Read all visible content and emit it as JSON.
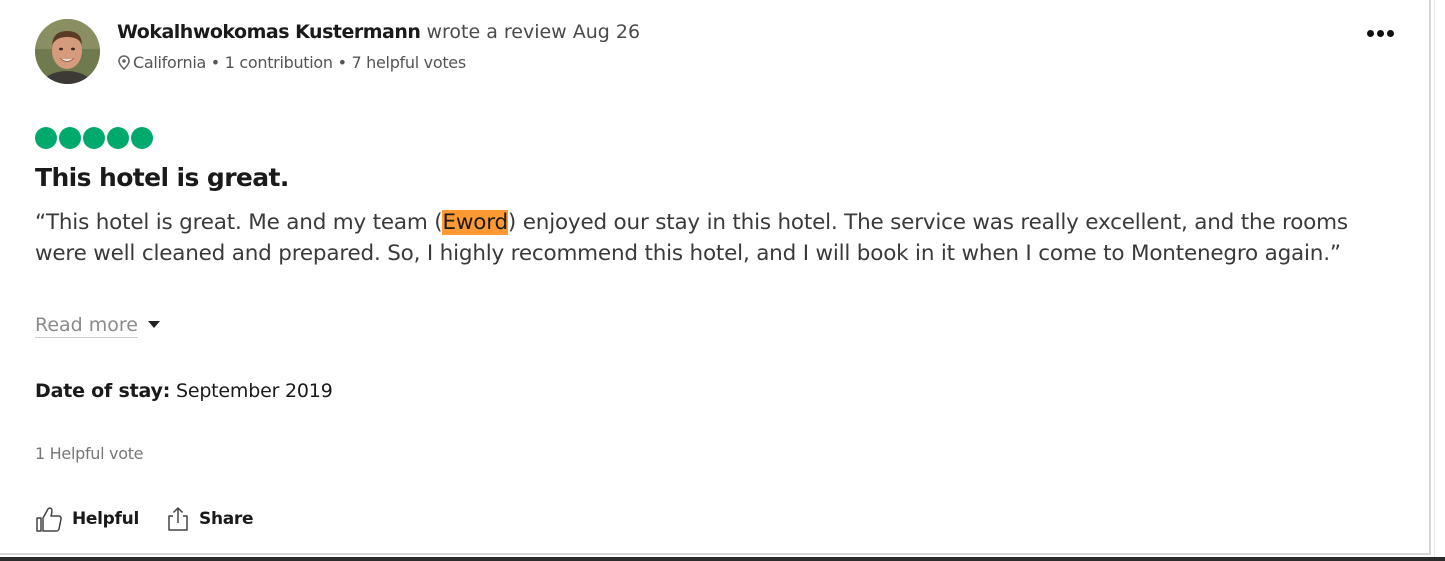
{
  "reviewer": {
    "name": "Wokalhwokomas Kustermann",
    "action": "wrote a review Aug 26",
    "location": "California",
    "contributions": "1 contribution",
    "helpful_votes": "7 helpful votes",
    "separator": "•"
  },
  "review": {
    "rating": 5,
    "rating_max": 5,
    "rating_color": "#00aa6c",
    "title": "This hotel is great.",
    "body_before": "“This hotel is great. Me and my team (",
    "body_highlight": "Eword",
    "body_after": ") enjoyed our stay in this hotel. The service was really excellent, and the rooms were well cleaned and prepared. So, I highly recommend this hotel, and I will book in it when I come to Montenegro again.”",
    "highlight_color": "#ff9933",
    "read_more_label": "Read more",
    "date_of_stay_label": "Date of stay:",
    "date_of_stay_value": "September 2019",
    "helpful_count": "1 Helpful vote"
  },
  "actions": {
    "helpful_label": "Helpful",
    "share_label": "Share"
  },
  "icons": {
    "more": "more-dots-icon",
    "location": "location-pin-icon",
    "helpful": "thumbs-up-icon",
    "share": "share-icon",
    "read_more": "caret-down-icon"
  }
}
